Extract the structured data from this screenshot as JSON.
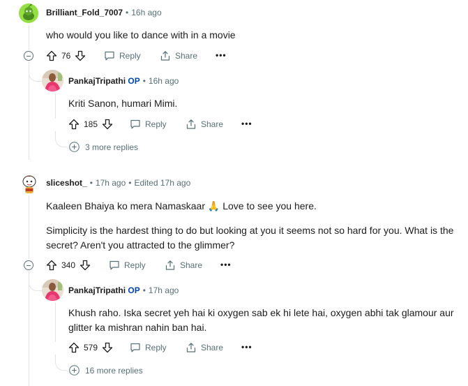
{
  "comments": [
    {
      "author": "Brilliant_Fold_7007",
      "time": "16h ago",
      "body": [
        "who would you like to dance with in a movie"
      ],
      "score": "76",
      "reply_label": "Reply",
      "share_label": "Share",
      "avatar": "snoo-avatar-green",
      "reply": {
        "author": "PankajTripathi",
        "op": "OP",
        "time": "16h ago",
        "body": [
          "Kriti Sanon, humari Mimi."
        ],
        "score": "185",
        "reply_label": "Reply",
        "share_label": "Share",
        "more_replies": "3 more replies"
      }
    },
    {
      "author": "sliceshot_",
      "time": "17h ago",
      "edited": "Edited 17h ago",
      "body": [
        "Kaaleen Bhaiya ko mera Namaskaar 🙏 Love to see you here.",
        "Simplicity is the hardest thing to do but looking at you it seems not so hard for you. What is the secret? Aren't you attracted to the glimmer?"
      ],
      "score": "340",
      "reply_label": "Reply",
      "share_label": "Share",
      "avatar": "snoo-avatar-cartoon",
      "reply": {
        "author": "PankajTripathi",
        "op": "OP",
        "time": "17h ago",
        "body": [
          "Khush raho. Iska secret yeh hai ki oxygen sab ek hi lete hai, oxygen abhi tak glamour aur glitter ka mishran nahin ban hai."
        ],
        "score": "579",
        "reply_label": "Reply",
        "share_label": "Share",
        "more_replies": "16 more replies"
      }
    }
  ],
  "colors": {
    "meta": "#576f76",
    "op": "#0045ac",
    "thread_line": "#e0e4e6"
  }
}
